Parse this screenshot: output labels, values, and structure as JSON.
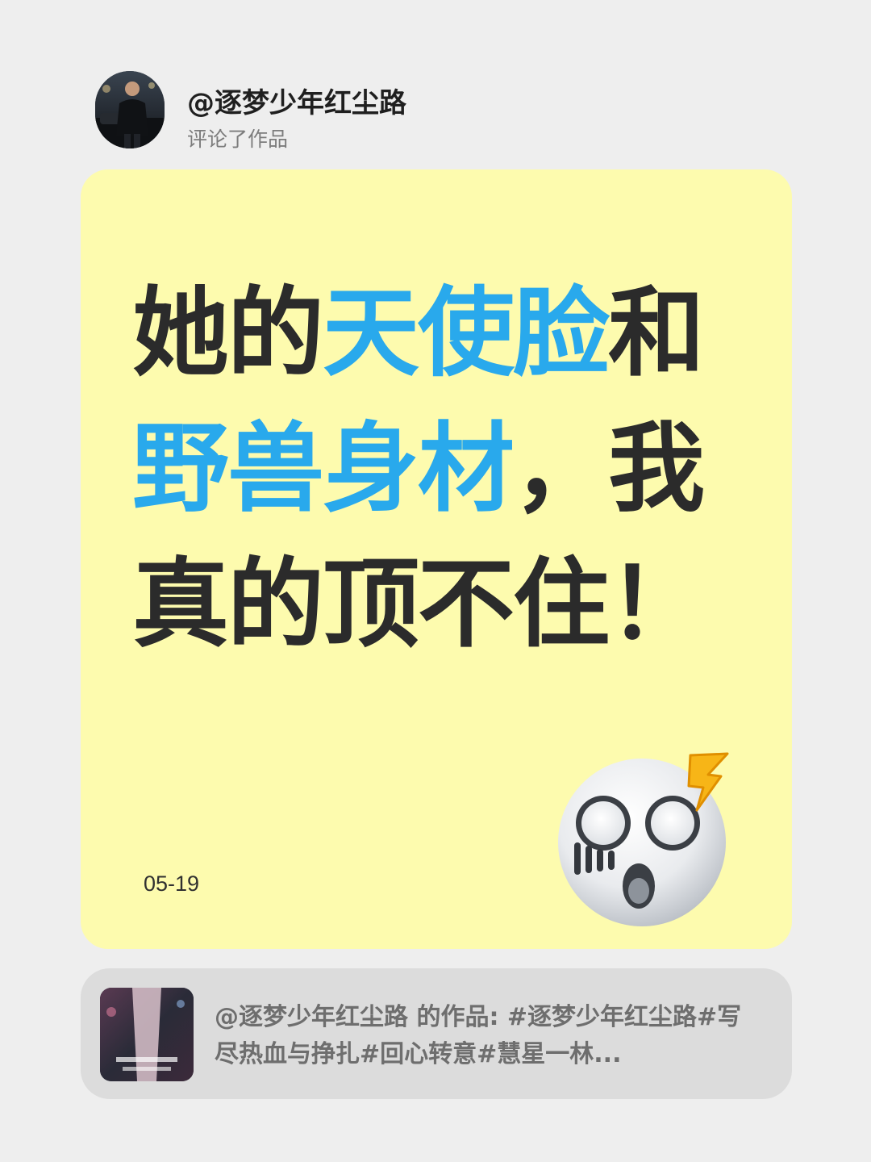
{
  "header": {
    "username": "@逐梦少年红尘路",
    "subtitle": "评论了作品"
  },
  "card": {
    "headline": {
      "line1_a": "她的",
      "line1_b": "天使脸",
      "line1_c": "和",
      "line2_a": "野兽身材",
      "line2_b": "，我",
      "line3": "真的顶不住！"
    },
    "date": "05-19",
    "emoji": "shocked-face-emoji"
  },
  "reference": {
    "line1": "@逐梦少年红尘路  的作品: #逐梦少年红尘路#写",
    "line2": "尽热血与挣扎#回心转意#慧星一林..."
  },
  "colors": {
    "background": "#eeeeee",
    "card": "#fdfbae",
    "highlight": "#29a9ec",
    "text_dark": "#2b2b2b",
    "reference_bg": "#dcdcdc"
  }
}
